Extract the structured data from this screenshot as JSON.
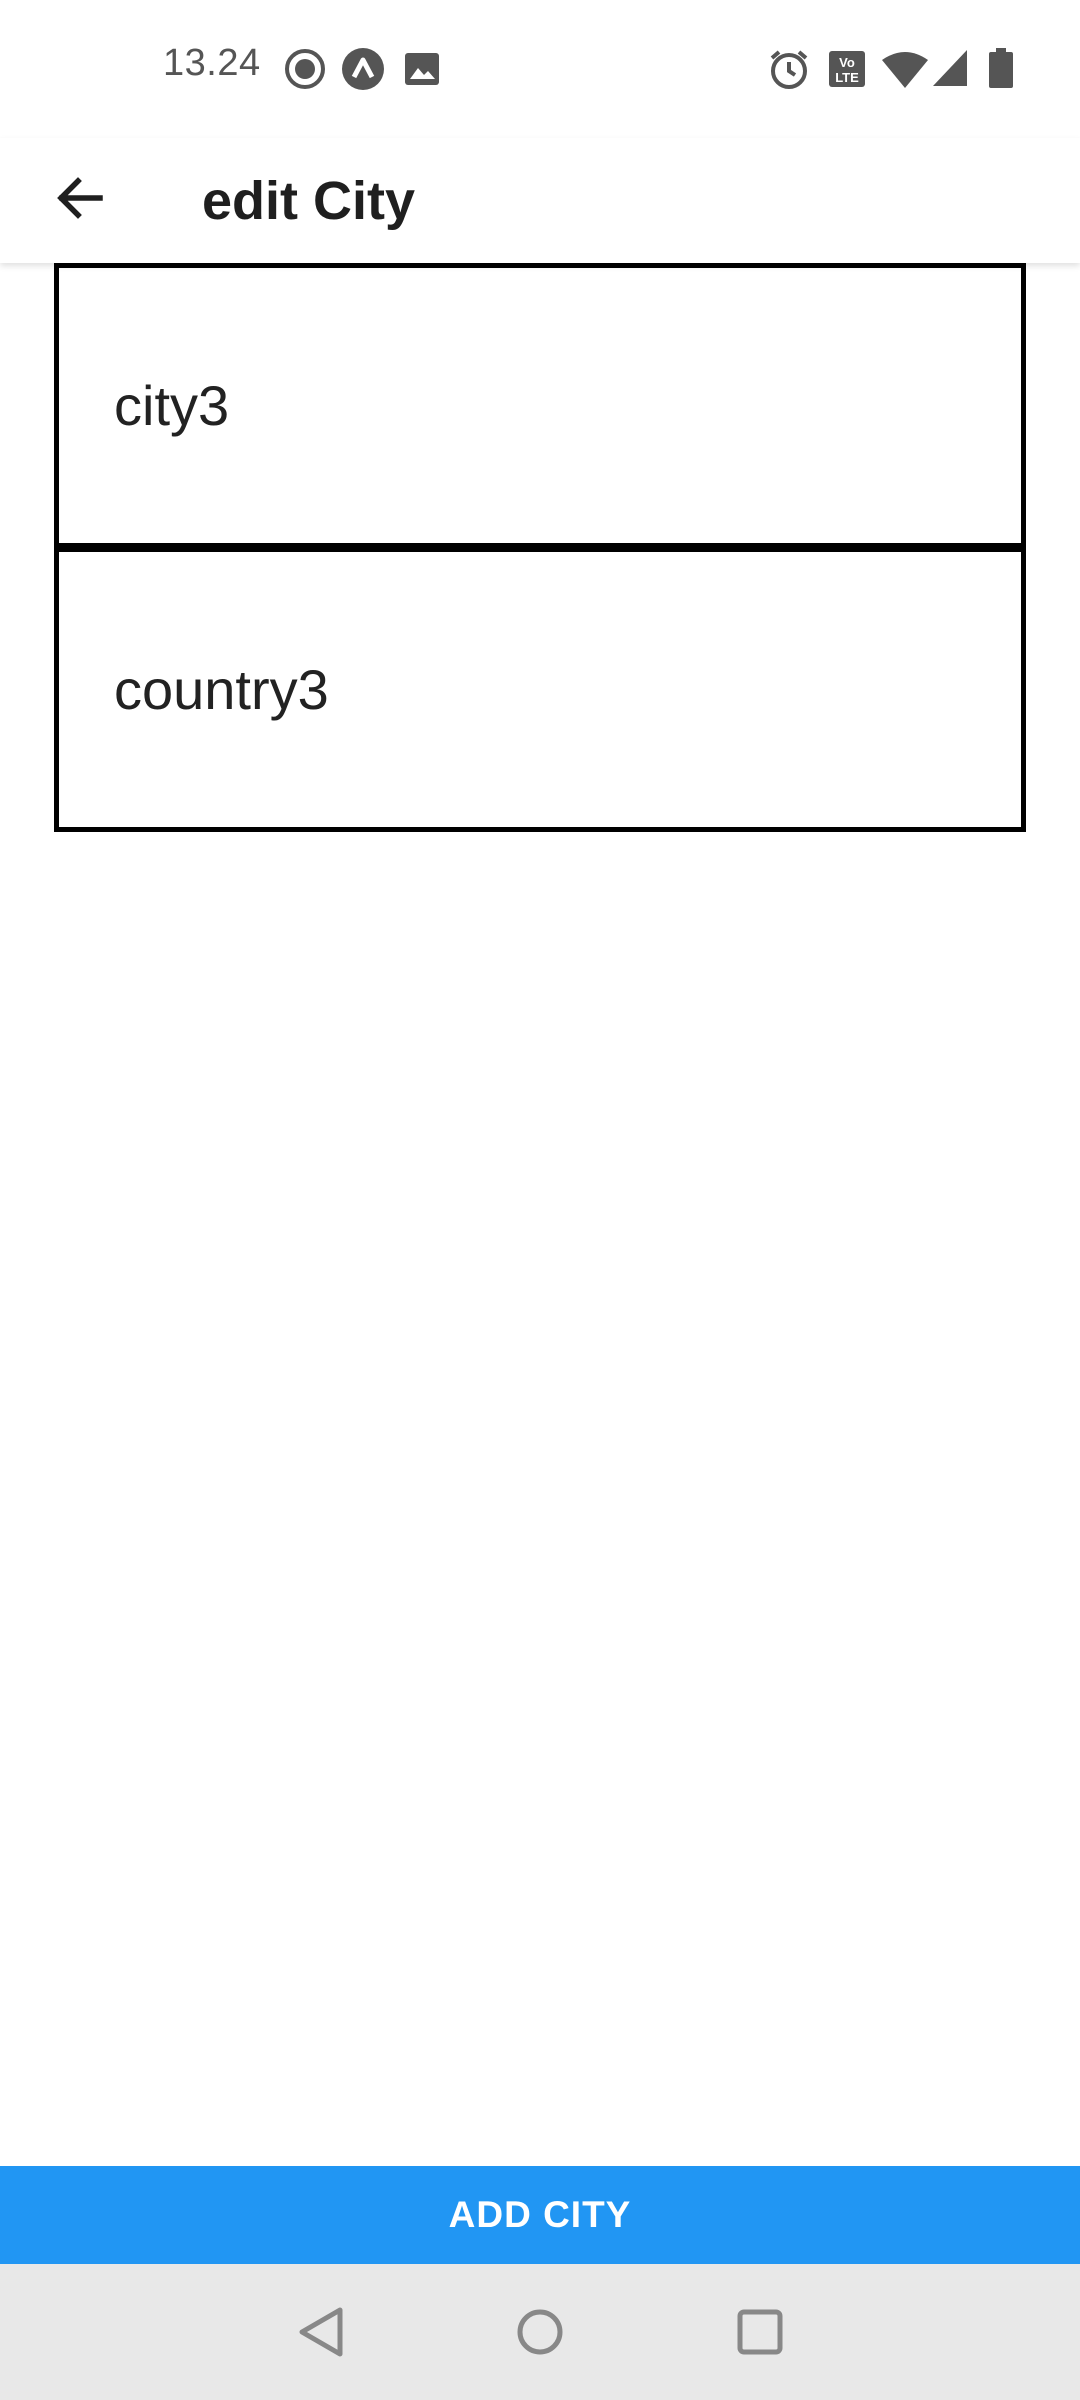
{
  "status_bar": {
    "time": "13.24",
    "icons_left": [
      "record-icon",
      "app-notification-icon",
      "image-icon"
    ],
    "icons_right": [
      "alarm-icon",
      "volte-icon",
      "wifi-icon",
      "signal-icon",
      "battery-icon"
    ]
  },
  "app_bar": {
    "title": "edit City",
    "back_icon": "arrow-left-icon"
  },
  "form": {
    "city_value": "city3",
    "country_value": "country3"
  },
  "actions": {
    "add_label": "ADD CITY"
  },
  "colors": {
    "primary": "#2196f3",
    "nav_bar": "#e8e8e8",
    "text": "#222222"
  },
  "nav_bar": {
    "buttons": [
      "back-triangle-icon",
      "home-circle-icon",
      "recents-square-icon"
    ]
  }
}
